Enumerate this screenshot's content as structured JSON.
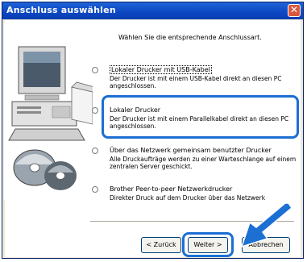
{
  "window": {
    "title": "Anschluss auswählen",
    "close_label": "✕"
  },
  "instruction": "Wählen Sie die entsprechende Anschlussart.",
  "options": [
    {
      "label": "Lokaler Drucker mit USB-Kabel",
      "description": "Der Drucker ist mit einem USB-Kabel direkt an diesen PC angeschlossen.",
      "selected": false
    },
    {
      "label": "Lokaler Drucker",
      "description": "Der Drucker ist mit einem Parallelkabel direkt an diesen PC angeschlossen.",
      "selected": false
    },
    {
      "label": "Über das Netzwerk gemeinsam benutzter Drucker",
      "description": "Alle Druckaufträge werden zu einer Warteschlange auf einem zentralen Server geschickt.",
      "selected": false
    },
    {
      "label": "Brother Peer-to-peer Netzwerkdrucker",
      "description": "Direkter Druck auf dem Drucker über das Netzwerk",
      "selected": false
    }
  ],
  "buttons": {
    "back": "< Zurück",
    "next": "Weiter >",
    "cancel": "Abbrechen"
  },
  "colors": {
    "highlight": "#1c6fd3",
    "titlebar": "#0b47c2"
  }
}
